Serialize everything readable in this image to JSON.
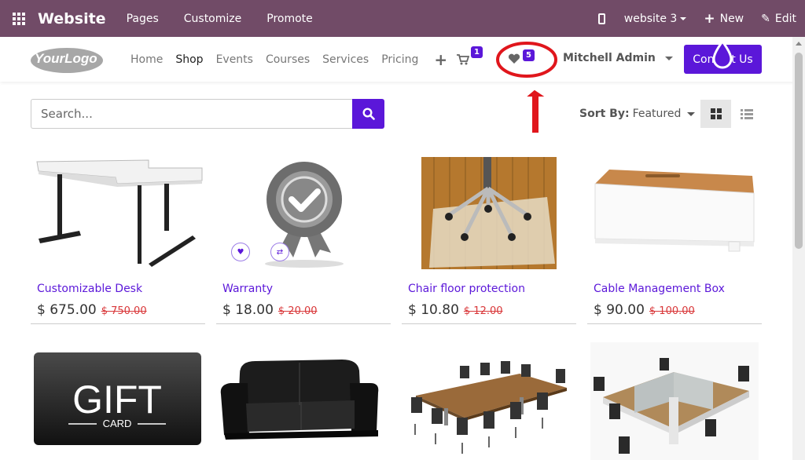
{
  "admin_bar": {
    "title": "Website",
    "menu": [
      "Pages",
      "Customize",
      "Promote"
    ],
    "website_selector": "website 3",
    "new_label": "New",
    "edit_label": "Edit",
    "bg_color": "#714b67"
  },
  "header": {
    "logo_text": "YourLogo",
    "nav": [
      "Home",
      "Shop",
      "Events",
      "Courses",
      "Services",
      "Pricing"
    ],
    "active_nav": "Shop",
    "cart_count": "1",
    "wishlist_count": "5",
    "user_name": "Mitchell Admin",
    "contact_label": "Contact Us",
    "accent_color": "#5b17d9"
  },
  "search": {
    "placeholder": "Search..."
  },
  "sort": {
    "label": "Sort By:",
    "value": "Featured"
  },
  "products": [
    {
      "name": "Customizable Desk",
      "price": "$ 675.00",
      "old_price": "$ 750.00",
      "image": "desk"
    },
    {
      "name": "Warranty",
      "price": "$ 18.00",
      "old_price": "$ 20.00",
      "image": "warranty-badge"
    },
    {
      "name": "Chair floor protection",
      "price": "$ 10.80",
      "old_price": "$ 12.00",
      "image": "chair-mat"
    },
    {
      "name": "Cable Management Box",
      "price": "$ 90.00",
      "old_price": "$ 100.00",
      "image": "cable-box"
    },
    {
      "name": "",
      "price": "",
      "old_price": "",
      "image": "gift-card",
      "card_text": "GIFT",
      "card_sub": "CARD"
    },
    {
      "name": "",
      "price": "",
      "old_price": "",
      "image": "sofa"
    },
    {
      "name": "",
      "price": "",
      "old_price": "",
      "image": "conference-table"
    },
    {
      "name": "",
      "price": "",
      "old_price": "",
      "image": "office-desks"
    }
  ],
  "annotation": {
    "color": "#e0161c"
  }
}
